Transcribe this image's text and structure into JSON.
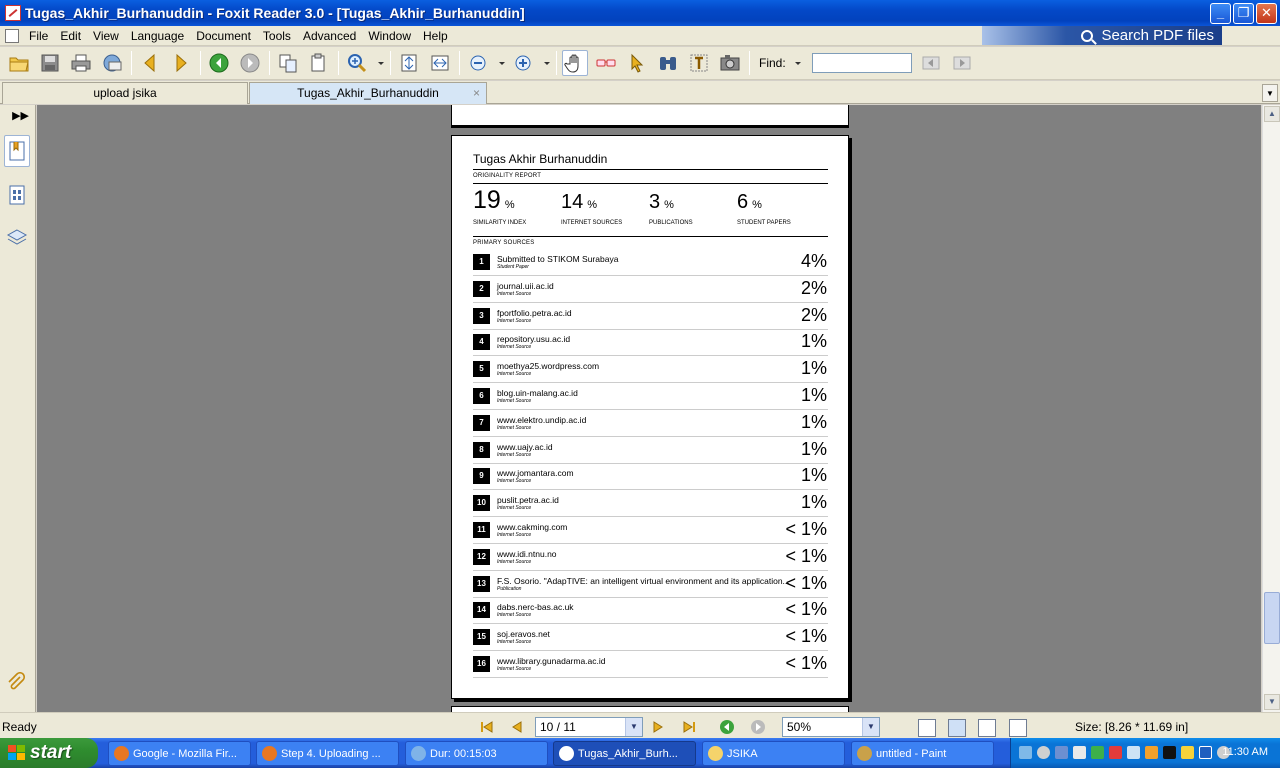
{
  "window": {
    "title": "Tugas_Akhir_Burhanuddin - Foxit Reader 3.0 - [Tugas_Akhir_Burhanuddin]",
    "minimize": "_",
    "restore": "❐",
    "close": "✕"
  },
  "menu": {
    "items": [
      "File",
      "Edit",
      "View",
      "Language",
      "Document",
      "Tools",
      "Advanced",
      "Window",
      "Help"
    ],
    "search_banner": "Search PDF files"
  },
  "toolbar": {
    "find_label": "Find:",
    "find_value": ""
  },
  "tabs": [
    {
      "label": "upload jsika",
      "active": false
    },
    {
      "label": "Tugas_Akhir_Burhanuddin",
      "active": true,
      "close": "×"
    }
  ],
  "report": {
    "title": "Tugas Akhir Burhanuddin",
    "section_originality": "ORIGINALITY REPORT",
    "stats": [
      {
        "value": "19",
        "unit": "%",
        "label": "SIMILARITY INDEX"
      },
      {
        "value": "14",
        "unit": "%",
        "label": "INTERNET SOURCES"
      },
      {
        "value": "3",
        "unit": "%",
        "label": "PUBLICATIONS"
      },
      {
        "value": "6",
        "unit": "%",
        "label": "STUDENT PAPERS"
      }
    ],
    "section_sources": "PRIMARY SOURCES",
    "sources": [
      {
        "num": "1",
        "name": "Submitted to STIKOM Surabaya",
        "type": "Student Paper",
        "pct": "4%"
      },
      {
        "num": "2",
        "name": "journal.uii.ac.id",
        "type": "Internet Source",
        "pct": "2%"
      },
      {
        "num": "3",
        "name": "fportfolio.petra.ac.id",
        "type": "Internet Source",
        "pct": "2%"
      },
      {
        "num": "4",
        "name": "repository.usu.ac.id",
        "type": "Internet Source",
        "pct": "1%"
      },
      {
        "num": "5",
        "name": "moethya25.wordpress.com",
        "type": "Internet Source",
        "pct": "1%"
      },
      {
        "num": "6",
        "name": "blog.uin-malang.ac.id",
        "type": "Internet Source",
        "pct": "1%"
      },
      {
        "num": "7",
        "name": "www.elektro.undip.ac.id",
        "type": "Internet Source",
        "pct": "1%"
      },
      {
        "num": "8",
        "name": "www.uajy.ac.id",
        "type": "Internet Source",
        "pct": "1%"
      },
      {
        "num": "9",
        "name": "www.jomantara.com",
        "type": "Internet Source",
        "pct": "1%"
      },
      {
        "num": "10",
        "name": "puslit.petra.ac.id",
        "type": "Internet Source",
        "pct": "1%"
      },
      {
        "num": "11",
        "name": "www.cakming.com",
        "type": "Internet Source",
        "pct": "< 1%"
      },
      {
        "num": "12",
        "name": "www.idi.ntnu.no",
        "type": "Internet Source",
        "pct": "< 1%"
      },
      {
        "num": "13",
        "name": "F.S. Osorio. \"AdapTIVE: an intelligent virtual environment and its application...",
        "type": "Publication",
        "pct": "< 1%"
      },
      {
        "num": "14",
        "name": "dabs.nerc-bas.ac.uk",
        "type": "Internet Source",
        "pct": "< 1%"
      },
      {
        "num": "15",
        "name": "soj.eravos.net",
        "type": "Internet Source",
        "pct": "< 1%"
      },
      {
        "num": "16",
        "name": "www.library.gunadarma.ac.id",
        "type": "Internet Source",
        "pct": "< 1%"
      }
    ]
  },
  "status": {
    "text": "Ready",
    "page": "10 / 11",
    "zoom": "50%",
    "size": "Size: [8.26 * 11.69 in]"
  },
  "taskbar": {
    "start": "start",
    "tasks": [
      {
        "label": "Google - Mozilla Fir...",
        "icon": "firefox-icon",
        "color": "#e87722"
      },
      {
        "label": "Step 4. Uploading ...",
        "icon": "firefox-icon",
        "color": "#e87722"
      },
      {
        "label": "Dur: 00:15:03",
        "icon": "recorder-icon",
        "color": "#7fb3e8"
      },
      {
        "label": "Tugas_Akhir_Burh...",
        "icon": "foxit-icon",
        "color": "#ffffff",
        "active": true
      },
      {
        "label": "JSIKA",
        "icon": "folder-icon",
        "color": "#f5d36b"
      },
      {
        "label": "untitled - Paint",
        "icon": "paint-icon",
        "color": "#c9a14a"
      }
    ],
    "clock": "11:30 AM"
  },
  "colors": {
    "titlebar": "#0348c7",
    "chrome": "#ece9d8",
    "doc_bg": "#808080",
    "taskbar": "#245edb",
    "start": "#2f8d2f"
  }
}
